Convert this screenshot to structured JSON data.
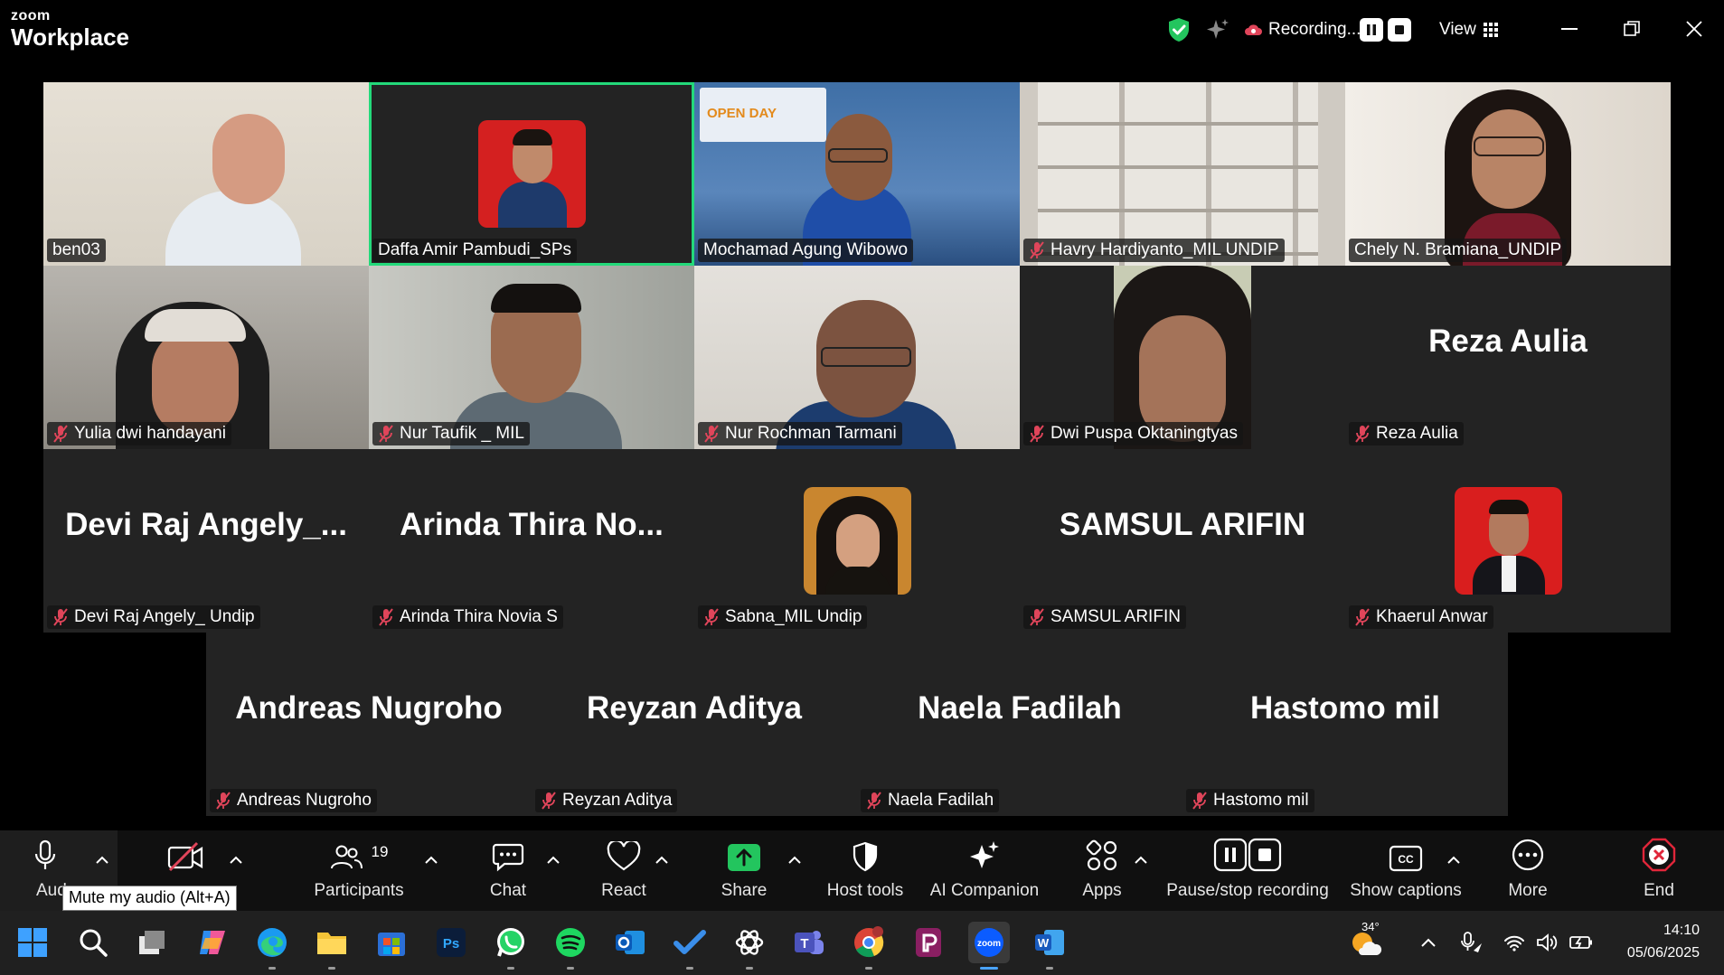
{
  "app": {
    "brand_small": "zoom",
    "brand_big": "Workplace"
  },
  "titlebar": {
    "recording_label": "Recording...",
    "view_label": "View",
    "security_icon": "shield-check-icon",
    "sparkle_icon": "ai-sparkle-icon"
  },
  "tiles": [
    {
      "name": "ben03",
      "muted": false,
      "video": true,
      "active": false
    },
    {
      "name": "Daffa Amir Pambudi_SPs",
      "muted": false,
      "video": false,
      "avatar": true,
      "active": true
    },
    {
      "name": "Mochamad Agung Wibowo",
      "muted": false,
      "video": true,
      "active": false
    },
    {
      "name": "Havry Hardiyanto_MIL UNDIP",
      "muted": true,
      "video": true,
      "active": false
    },
    {
      "name": "Chely N. Bramiana_UNDIP",
      "muted": false,
      "video": true,
      "active": false
    },
    {
      "name": "Yulia dwi handayani",
      "muted": true,
      "video": true,
      "active": false
    },
    {
      "name": "Nur Taufik _ MIL",
      "muted": true,
      "video": true,
      "active": false
    },
    {
      "name": "Nur Rochman Tarmani",
      "muted": true,
      "video": true,
      "active": false
    },
    {
      "name": "Dwi Puspa Oktaningtyas",
      "muted": true,
      "video": true,
      "active": false
    },
    {
      "name": "Reza Aulia",
      "display": "Reza Aulia",
      "muted": true,
      "video": false,
      "active": false
    },
    {
      "name": "Devi Raj Angely_ Undip",
      "display": "Devi Raj Angely_...",
      "muted": true,
      "video": false,
      "active": false
    },
    {
      "name": "Arinda Thira Novia S",
      "display": "Arinda Thira No...",
      "muted": true,
      "video": false,
      "active": false
    },
    {
      "name": "Sabna_MIL Undip",
      "muted": true,
      "video": false,
      "avatar": true,
      "active": false
    },
    {
      "name": "SAMSUL ARIFIN",
      "display": "SAMSUL ARIFIN",
      "muted": true,
      "video": false,
      "active": false
    },
    {
      "name": "Khaerul Anwar",
      "muted": true,
      "video": false,
      "avatar": true,
      "active": false
    },
    {
      "name": "Andreas Nugroho",
      "display": "Andreas Nugroho",
      "muted": true,
      "video": false,
      "active": false
    },
    {
      "name": "Reyzan Aditya",
      "display": "Reyzan Aditya",
      "muted": true,
      "video": false,
      "active": false
    },
    {
      "name": "Naela Fadilah",
      "display": "Naela Fadilah",
      "muted": true,
      "video": false,
      "active": false
    },
    {
      "name": "Hastomo mil",
      "display": "Hastomo mil",
      "muted": true,
      "video": false,
      "active": false
    }
  ],
  "controls": {
    "audio_label": "Aud",
    "audio_tooltip": "Mute my audio (Alt+A)",
    "participants_label": "Participants",
    "participants_count": "19",
    "chat_label": "Chat",
    "react_label": "React",
    "share_label": "Share",
    "host_tools_label": "Host tools",
    "ai_companion_label": "AI Companion",
    "apps_label": "Apps",
    "recording_label": "Pause/stop recording",
    "captions_label": "Show captions",
    "more_label": "More",
    "end_label": "End"
  },
  "taskbar": {
    "weather_temp": "34°",
    "time": "14:10",
    "date": "05/06/2025",
    "apps": [
      "windows-start-icon",
      "search-icon",
      "task-view-icon",
      "copilot-icon",
      "edge-icon",
      "file-explorer-icon",
      "microsoft-store-icon",
      "photoshop-icon",
      "whatsapp-icon",
      "spotify-icon",
      "outlook-icon",
      "todo-icon",
      "chatgpt-icon",
      "teams-icon",
      "chrome-icon",
      "pdf-icon",
      "zoom-icon",
      "word-icon"
    ]
  },
  "colors": {
    "active_speaker": "#23d97a",
    "muted_mic": "#e0455a",
    "share_green": "#23c55e",
    "end_red": "#e0263a",
    "zoom_blue": "#0b5cff"
  }
}
